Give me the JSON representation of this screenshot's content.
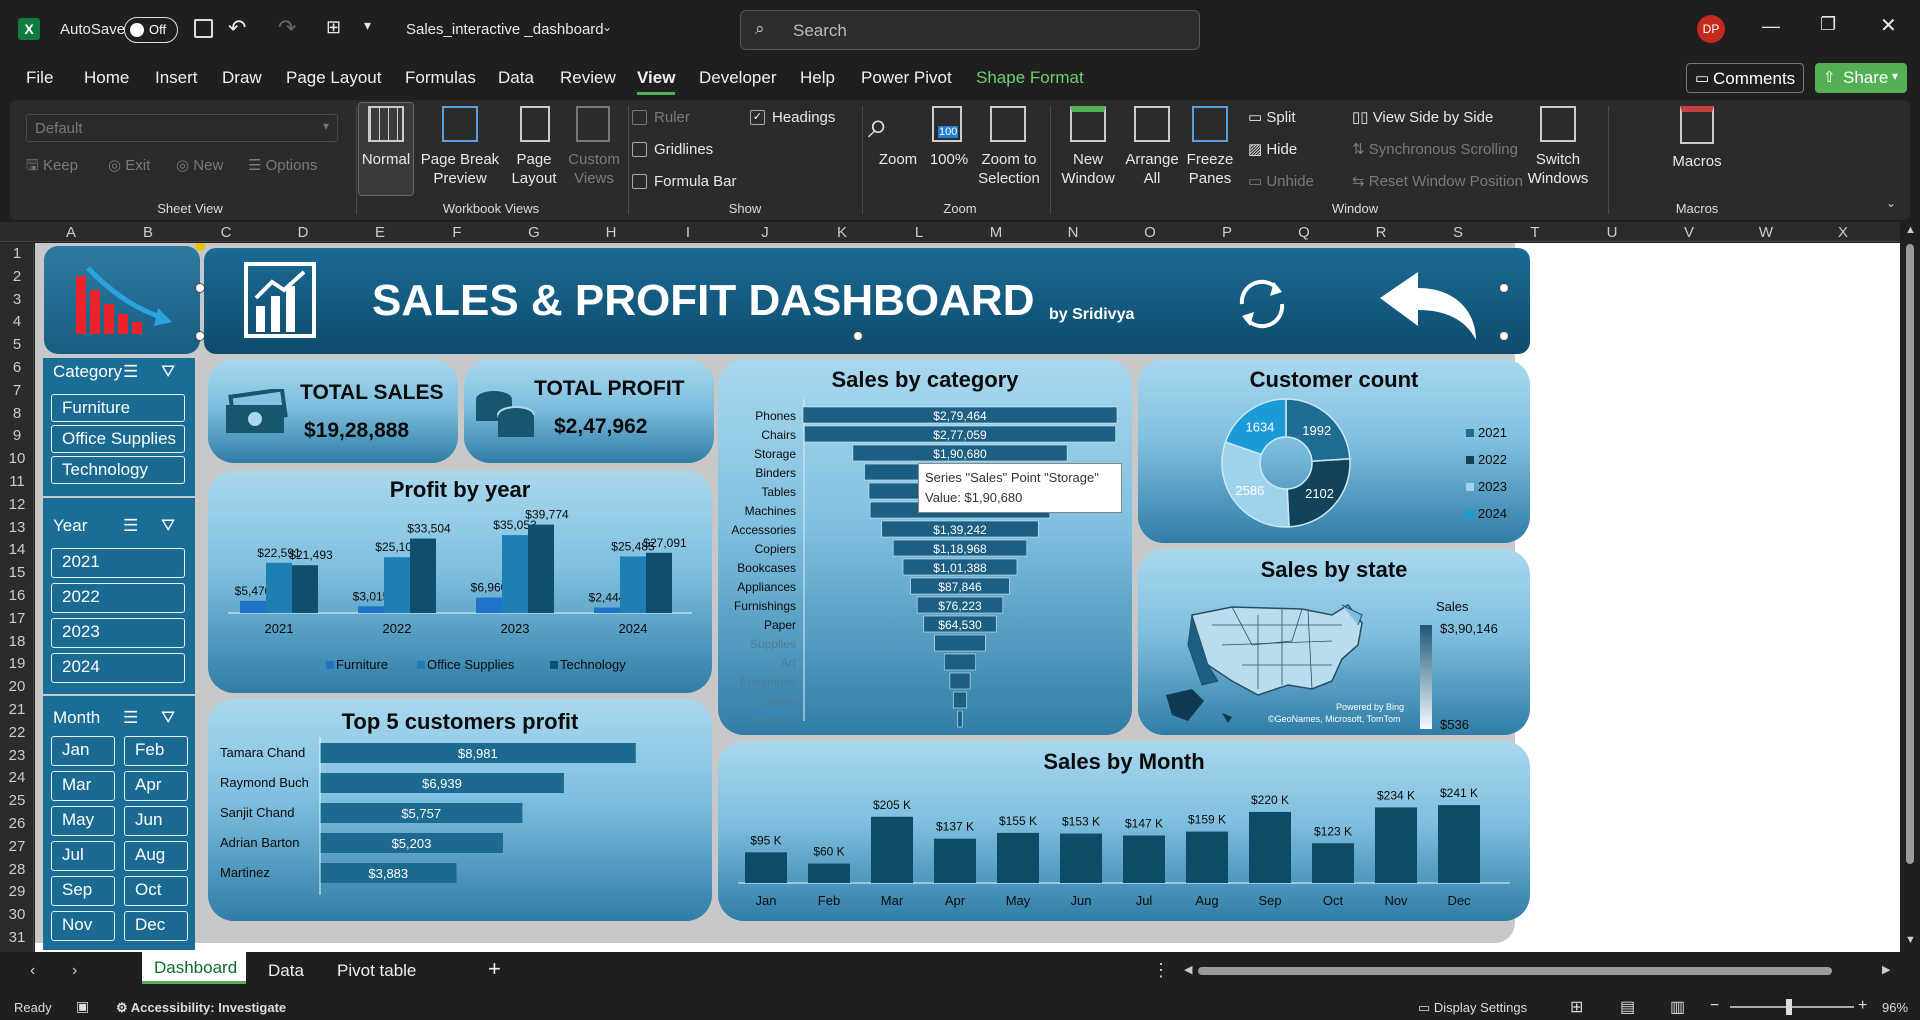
{
  "titlebar": {
    "app_icon": "excel-icon",
    "autosave_label": "AutoSave",
    "autosave_state": "Off",
    "filename": "Sales_interactive _dashboard",
    "search_placeholder": "Search",
    "user_initials": "DP"
  },
  "menu": {
    "tabs": [
      "File",
      "Home",
      "Insert",
      "Draw",
      "Page Layout",
      "Formulas",
      "Data",
      "Review",
      "View",
      "Developer",
      "Help",
      "Power Pivot",
      "Shape Format"
    ],
    "active": "View",
    "comments": "Comments",
    "share": "Share"
  },
  "ribbon": {
    "sheetview": {
      "dropdown": "Default",
      "keep": "Keep",
      "exit": "Exit",
      "new": "New",
      "options": "Options",
      "label": "Sheet View"
    },
    "workbookviews": {
      "normal": "Normal",
      "pagebreak": "Page Break Preview",
      "pagelayout": "Page Layout",
      "custom": "Custom Views",
      "label": "Workbook Views"
    },
    "show": {
      "ruler": "Ruler",
      "headings": "Headings",
      "gridlines": "Gridlines",
      "formulabar": "Formula Bar",
      "label": "Show"
    },
    "zoom": {
      "zoom": "Zoom",
      "hundred": "100%",
      "selection": "Zoom to Selection",
      "label": "Zoom",
      "badge": "100"
    },
    "window": {
      "newwindow": "New Window",
      "arrange": "Arrange All",
      "freeze": "Freeze Panes",
      "split": "Split",
      "hide": "Hide",
      "unhide": "Unhide",
      "sidebyside": "View Side by Side",
      "sync": "Synchronous Scrolling",
      "reset": "Reset Window Position",
      "switch": "Switch Windows",
      "label": "Window"
    },
    "macros": {
      "macros": "Macros",
      "label": "Macros"
    }
  },
  "columns": [
    "A",
    "B",
    "C",
    "D",
    "E",
    "F",
    "G",
    "H",
    "I",
    "J",
    "K",
    "L",
    "M",
    "N",
    "O",
    "P",
    "Q",
    "R",
    "S",
    "T",
    "U",
    "V",
    "W",
    "X"
  ],
  "rows": [
    "1",
    "2",
    "3",
    "4",
    "5",
    "6",
    "7",
    "8",
    "9",
    "10",
    "11",
    "12",
    "13",
    "14",
    "15",
    "16",
    "17",
    "18",
    "19",
    "20",
    "21",
    "22",
    "23",
    "24",
    "25",
    "26",
    "27",
    "28",
    "29",
    "30",
    "31"
  ],
  "dashboard": {
    "title": "SALES & PROFIT DASHBOARD",
    "byline": "by Sridivya",
    "total_sales_label": "TOTAL SALES",
    "total_sales_value": "$19,28,888",
    "total_profit_label": "TOTAL PROFIT",
    "total_profit_value": "$2,47,962",
    "slicers": {
      "category": {
        "title": "Category",
        "items": [
          "Furniture",
          "Office Supplies",
          "Technology"
        ]
      },
      "year": {
        "title": "Year",
        "items": [
          "2021",
          "2022",
          "2023",
          "2024"
        ]
      },
      "month": {
        "title": "Month",
        "items": [
          "Jan",
          "Feb",
          "Mar",
          "Apr",
          "May",
          "Jun",
          "Jul",
          "Aug",
          "Sep",
          "Oct",
          "Nov",
          "Dec"
        ]
      }
    },
    "tooltip": {
      "line1": "Series \"Sales\" Point \"Storage\"",
      "line2": "Value:  $1,90,680"
    },
    "map_attrib1": "Powered by Bing",
    "map_attrib2": "©GeoNames, Microsoft, TomTom"
  },
  "chart_data": [
    {
      "type": "bar",
      "title": "Profit by year",
      "categories": [
        "2021",
        "2022",
        "2023",
        "2024"
      ],
      "series": [
        {
          "name": "Furniture",
          "values": [
            5470,
            3015,
            6960,
            2444
          ],
          "labels": [
            "$5,470",
            "$3,015",
            "$6,960",
            "$2,444"
          ]
        },
        {
          "name": "Office Supplies",
          "values": [
            22591,
            25100,
            35053,
            25485
          ],
          "labels": [
            "$22,591",
            "$25,100",
            "$35,053",
            "$25,485"
          ]
        },
        {
          "name": "Technology",
          "values": [
            21493,
            33504,
            39774,
            27091
          ],
          "labels": [
            "$21,493",
            "$33,504",
            "$39,774",
            "$27,091"
          ]
        }
      ],
      "colors": [
        "#1f74c9",
        "#1e7fb2",
        "#0f4f6d"
      ],
      "ylim": [
        0,
        45000
      ]
    },
    {
      "type": "bar",
      "title": "Sales by category",
      "orientation": "horizontal",
      "categories": [
        "Phones",
        "Chairs",
        "Storage",
        "Binders",
        "Tables",
        "Machines",
        "Accessories",
        "Copiers",
        "Bookcases",
        "Appliances",
        "Furnishings",
        "Paper",
        "Supplies",
        "Art",
        "Envelopes",
        "Labels",
        "Fasteners"
      ],
      "values": [
        279464,
        277059,
        190680,
        170000,
        162000,
        160000,
        139242,
        118968,
        101388,
        87846,
        76223,
        64530,
        45000,
        28000,
        18000,
        12000,
        4000
      ],
      "labels": [
        "$2,79,464",
        "$2,77,059",
        "$1,90,680",
        "",
        "",
        "",
        "$1,39,242",
        "$1,18,968",
        "$1,01,388",
        "$87,846",
        "$76,223",
        "$64,530",
        "",
        "",
        "",
        "",
        ""
      ],
      "color": "#1d5f82"
    },
    {
      "type": "pie",
      "title": "Customer count",
      "labels": [
        "2021",
        "2022",
        "2023",
        "2024"
      ],
      "values": [
        1992,
        2102,
        2586,
        1634
      ],
      "colors": [
        "#1f6d93",
        "#12435b",
        "#9fd3ec",
        "#1a9bd7"
      ]
    },
    {
      "type": "other",
      "title": "Sales by state",
      "legend_title": "Sales",
      "legend_max": "$3,90,146",
      "legend_min": "$536"
    },
    {
      "type": "bar",
      "title": "Top 5 customers profit",
      "orientation": "horizontal",
      "categories": [
        "Tamara Chand",
        "Raymond Buch",
        "Sanjit Chand",
        "Adrian Barton",
        "Martinez"
      ],
      "values": [
        8981,
        6939,
        5757,
        5203,
        3883
      ],
      "labels": [
        "$8,981",
        "$6,939",
        "$5,757",
        "$5,203",
        "$3,883"
      ],
      "color": "#1d6a91"
    },
    {
      "type": "bar",
      "title": "Sales by Month",
      "categories": [
        "Jan",
        "Feb",
        "Mar",
        "Apr",
        "May",
        "Jun",
        "Jul",
        "Aug",
        "Sep",
        "Oct",
        "Nov",
        "Dec"
      ],
      "values": [
        95,
        60,
        205,
        137,
        155,
        153,
        147,
        159,
        220,
        123,
        234,
        241
      ],
      "labels": [
        "$95 K",
        "$60 K",
        "$205 K",
        "$137 K",
        "$155 K",
        "$153 K",
        "$147 K",
        "$159 K",
        "$220 K",
        "$123 K",
        "$234 K",
        "$241 K"
      ],
      "color": "#0e4b67",
      "ylim": [
        0,
        260
      ]
    }
  ],
  "sheets": {
    "tabs": [
      "Dashboard",
      "Data",
      "Pivot table"
    ],
    "active": "Dashboard"
  },
  "status": {
    "ready": "Ready",
    "accessibility": "Accessibility: Investigate",
    "display": "Display Settings",
    "zoom": "96%"
  }
}
